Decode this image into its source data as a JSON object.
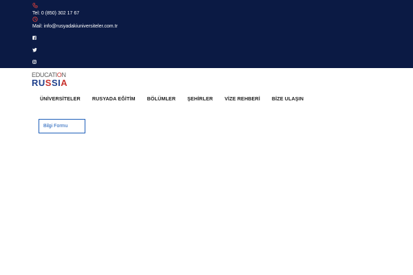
{
  "topbar": {
    "phone_text": "Tel: 0 (850) 302 17 67",
    "mail_text": "Mail: info@rusyadakiuniversiteler.com.tr",
    "icons": [
      "phone-icon",
      "clock-icon",
      "facebook-icon",
      "twitter-icon",
      "instagram-icon"
    ],
    "background_color": "#0b1a44",
    "accent_color": "#e0413a"
  },
  "logo": {
    "line1_prefix": "EDUCATI",
    "line1_o": "O",
    "line1_suffix": "N",
    "line2_letters": [
      "R",
      "U",
      "S",
      "S",
      "I",
      "A"
    ],
    "colors": [
      "#1e3f8c",
      "#1e3f8c",
      "#c8312c",
      "#1e3f8c",
      "#1e3f8c",
      "#c8312c"
    ]
  },
  "nav": {
    "items": [
      {
        "label": "ÜNİVERSİTELER"
      },
      {
        "label": "RUSYADA EĞİTİM"
      },
      {
        "label": "BÖLÜMLER"
      },
      {
        "label": "ŞEHİRLER"
      },
      {
        "label": "VİZE REHBERİ"
      },
      {
        "label": "BİZE ULAŞIN"
      }
    ]
  },
  "form_button": {
    "label": "Bilgi Formu",
    "color": "#1a5cb8"
  }
}
